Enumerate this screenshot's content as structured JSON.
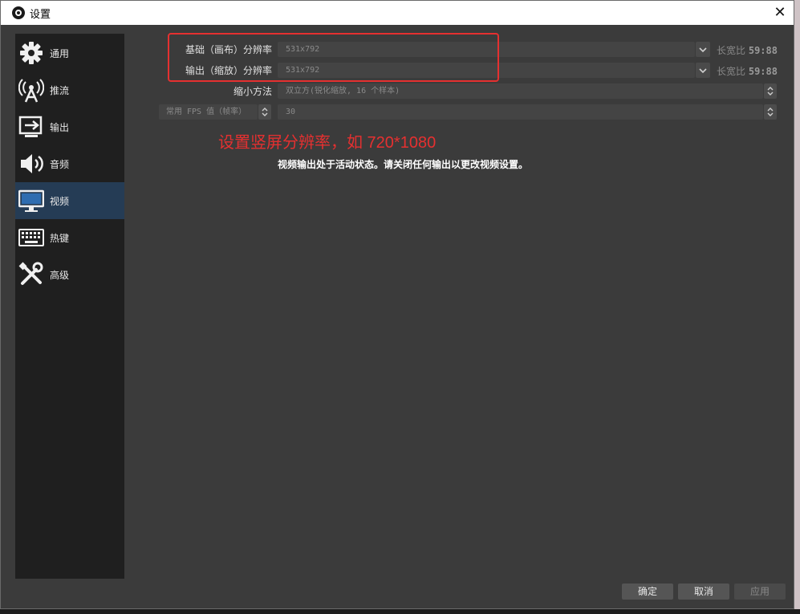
{
  "window": {
    "title": "设置",
    "close_glyph": "✕"
  },
  "sidebar": {
    "items": [
      {
        "label": "通用",
        "icon": "gear-icon"
      },
      {
        "label": "推流",
        "icon": "broadcast-antenna-icon"
      },
      {
        "label": "输出",
        "icon": "output-icon"
      },
      {
        "label": "音频",
        "icon": "speaker-icon"
      },
      {
        "label": "视频",
        "icon": "monitor-icon",
        "active": true
      },
      {
        "label": "热键",
        "icon": "keyboard-icon"
      },
      {
        "label": "高级",
        "icon": "tools-icon"
      }
    ]
  },
  "video": {
    "base_resolution_label": "基础（画布）分辨率",
    "base_resolution_value": "531x792",
    "base_aspect_label": "长宽比",
    "base_aspect_value": "59:88",
    "output_resolution_label": "输出（缩放）分辨率",
    "output_resolution_value": "531x792",
    "output_aspect_label": "长宽比",
    "output_aspect_value": "59:88",
    "downscale_label": "缩小方法",
    "downscale_value": "双立方(锐化缩放, 16 个样本)",
    "fps_type_value": "常用 FPS 值（帧率）",
    "fps_value": "30"
  },
  "annotation": "设置竖屏分辨率，如 720*1080",
  "notice": "视频输出处于活动状态。请关闭任何输出以更改视频设置。",
  "buttons": {
    "ok": "确定",
    "cancel": "取消",
    "apply": "应用"
  },
  "colors": {
    "accent_red": "#e53030",
    "active_nav": "#253c55"
  }
}
